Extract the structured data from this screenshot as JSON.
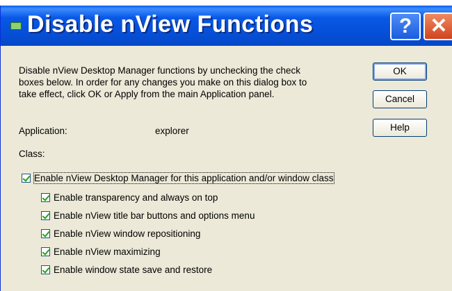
{
  "dialog": {
    "title": "Disable nView Functions",
    "title_help_glyph": "?",
    "title_close_glyph": "✕",
    "description": "Disable nView Desktop Manager functions by unchecking the check boxes below. In order for any changes you make on this dialog box to take effect, click OK or Apply from the main Application panel.",
    "application_label": "Application:",
    "application_value": "explorer",
    "class_label": "Class:"
  },
  "buttons": {
    "ok": "OK",
    "cancel": "Cancel",
    "help": "Help"
  },
  "checkboxes": [
    {
      "label": "Enable nView Desktop Manager for this application and/or window class",
      "checked": true
    },
    {
      "label": "Enable transparency and always on top",
      "checked": true
    },
    {
      "label": "Enable nView title bar buttons and options menu",
      "checked": true
    },
    {
      "label": "Enable nView window repositioning",
      "checked": true
    },
    {
      "label": "Enable nView maximizing",
      "checked": true
    },
    {
      "label": "Enable window state save and restore",
      "checked": true
    }
  ],
  "colors": {
    "titlebar": "#0558e2",
    "dialog_bg": "#ece9d8",
    "check_mark": "#21a121"
  },
  "icons": [
    "app-icon",
    "help-icon",
    "close-icon",
    "checkmark-icon"
  ]
}
